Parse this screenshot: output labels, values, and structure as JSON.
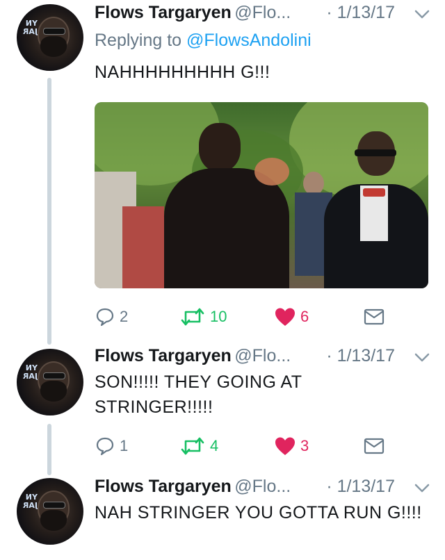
{
  "tweets": [
    {
      "name": "Flows Targaryen",
      "handle": "@Flo...",
      "time": "· 1/13/17",
      "replying_prefix": "Replying to ",
      "replying_handle": "@FlowsAndolini",
      "text": "NAHHHHHHHHH G!!!",
      "has_media": true,
      "replies": "2",
      "retweets": "10",
      "likes": "6"
    },
    {
      "name": "Flows Targaryen",
      "handle": "@Flo...",
      "time": "· 1/13/17",
      "text": "SON!!!!! THEY GOING AT STRINGER!!!!!",
      "replies": "1",
      "retweets": "4",
      "likes": "3"
    },
    {
      "name": "Flows Targaryen",
      "handle": "@Flo...",
      "time": "· 1/13/17",
      "text": "NAH STRINGER YOU GOTTA RUN G!!!!"
    }
  ],
  "avatar_sign_text": "YN JAR",
  "colors": {
    "retweet_green": "#17bf63",
    "like_red": "#e0245e",
    "link_blue": "#1da1f2",
    "secondary_gray": "#657786",
    "thread_line": "#ccd6dd"
  },
  "icons": [
    "reply-icon",
    "retweet-icon",
    "heart-icon",
    "mail-icon",
    "chevron-down-icon"
  ]
}
